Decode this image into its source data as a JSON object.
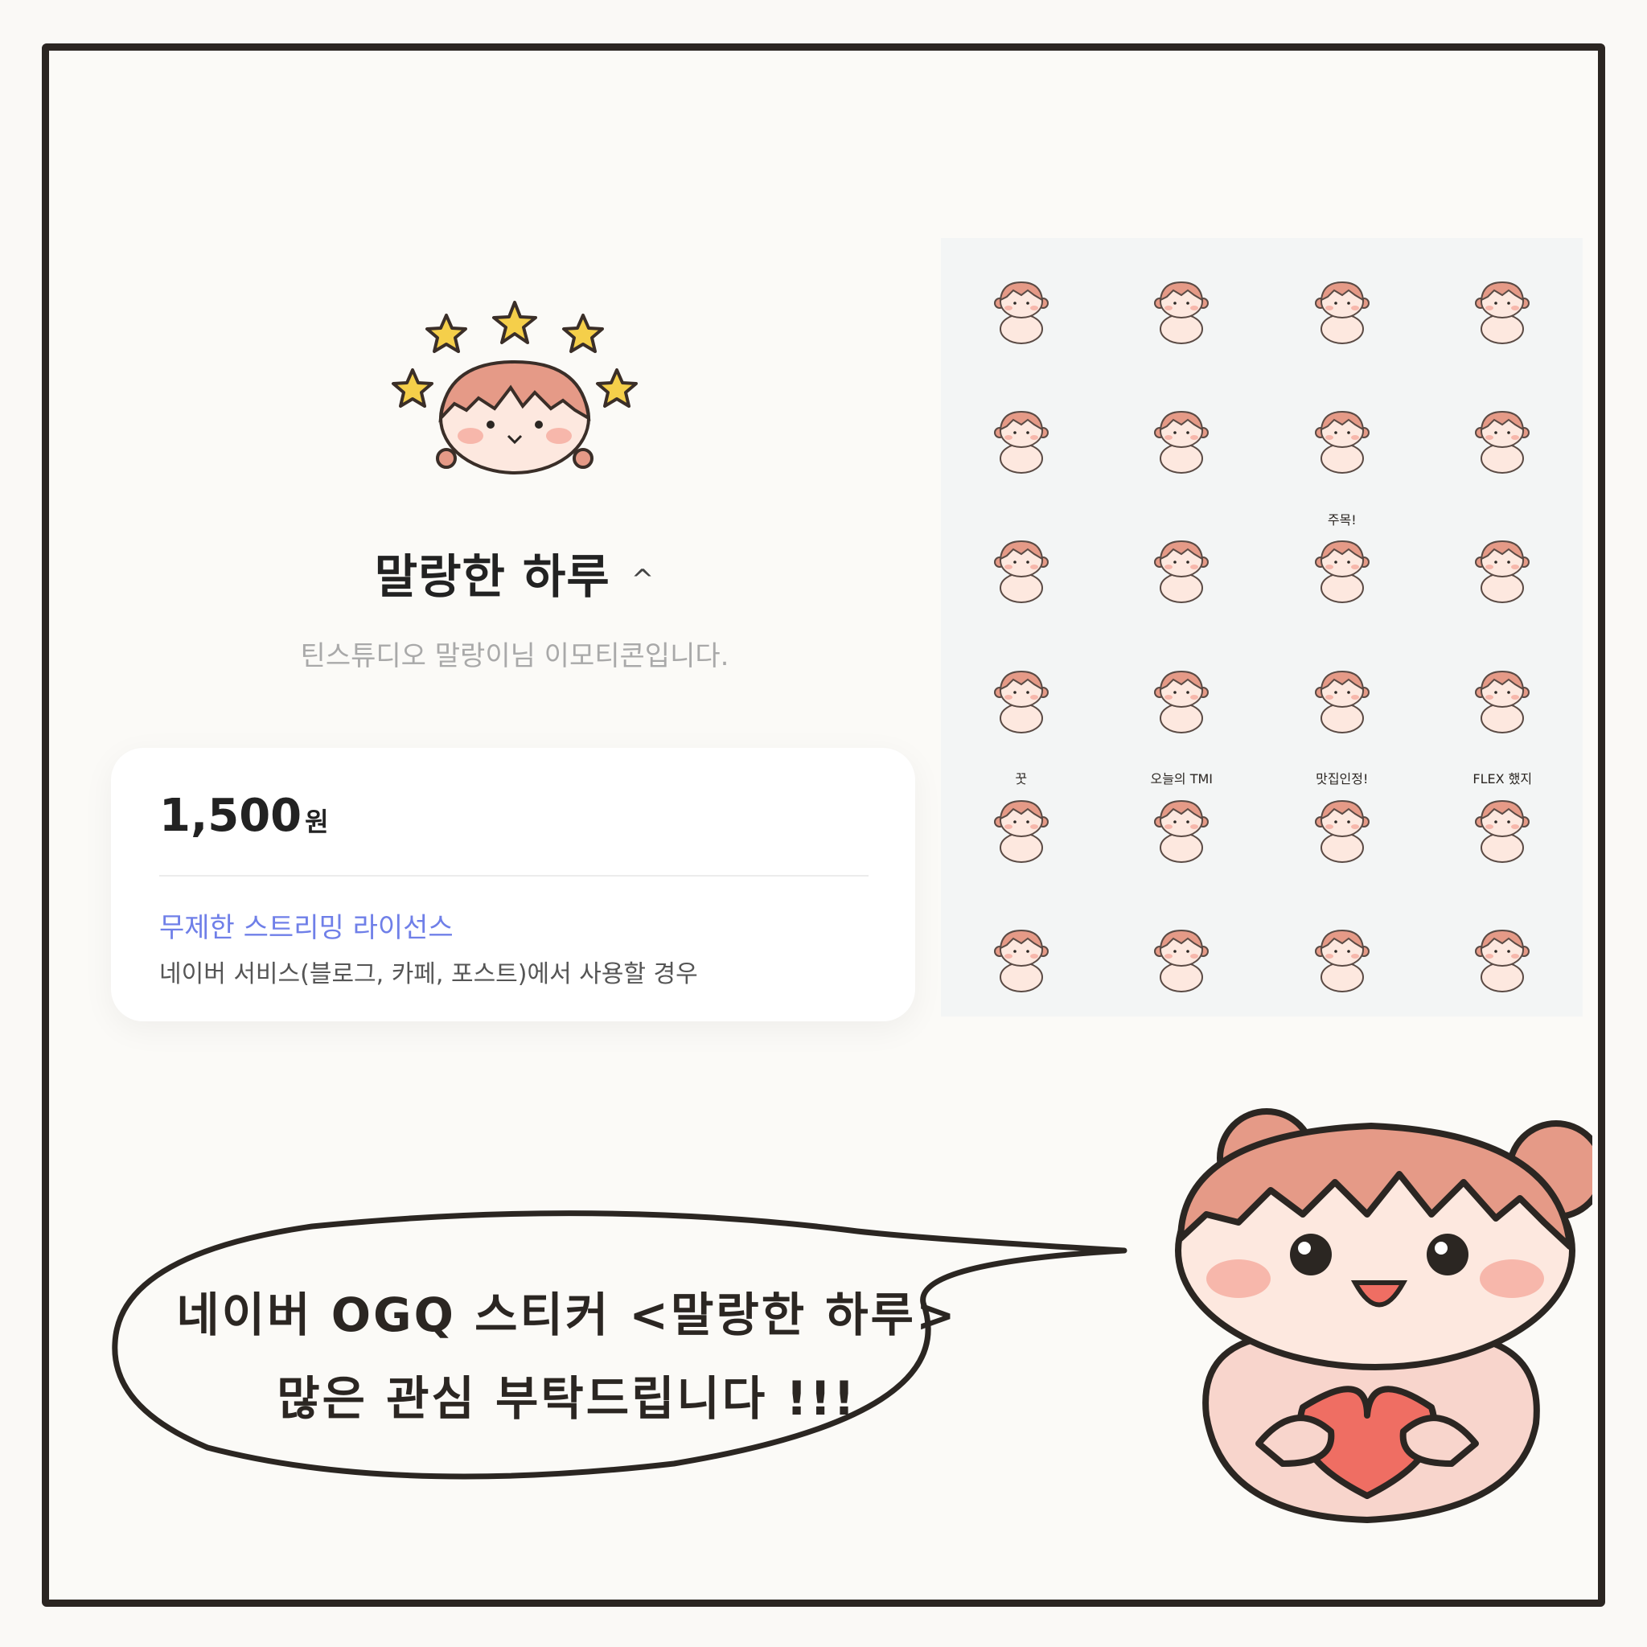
{
  "product": {
    "title": "말랑한 하루",
    "chevron": "^",
    "subtitle": "틴스튜디오 말랑이님 이모티콘입니다.",
    "price_value": "1,500",
    "price_unit": "원",
    "license_label": "무제한 스트리밍 라이선스",
    "license_desc": "네이버 서비스(블로그, 카페, 포스트)에서 사용할 경우"
  },
  "stickers": {
    "count": 24,
    "captions": [
      "주목!",
      "꿋",
      "오늘의 TMI",
      "맛집인정!",
      "FLEX 했지"
    ]
  },
  "speech": {
    "line1": "네이버 OGQ 스티커 <말랑한 하루>",
    "line2": "많은 관심 부탁드립니다 !!!"
  },
  "colors": {
    "hair": "#e59a87",
    "skin": "#fde8df",
    "cheek": "#f7b7ab",
    "star": "#f5cf4a",
    "heart": "#ef6e63",
    "outline": "#2b2622",
    "license": "#6f7fe8"
  }
}
